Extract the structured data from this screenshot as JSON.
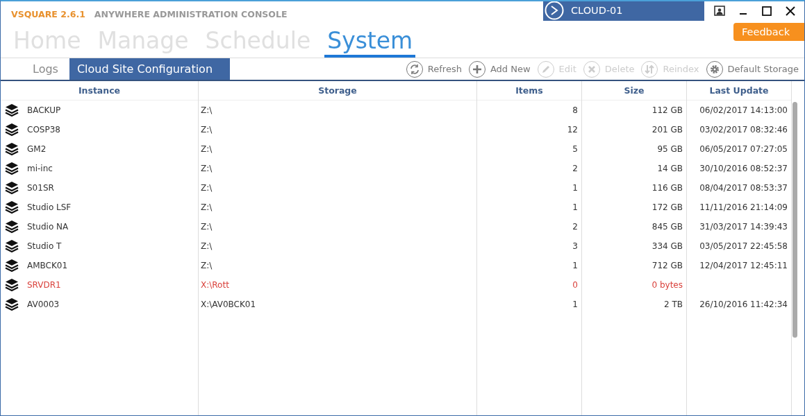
{
  "app": {
    "name": "VSQUARE 2.6.1",
    "subtitle": "ANYWHERE ADMINISTRATION CONSOLE"
  },
  "server": {
    "label": "CLOUD-01"
  },
  "feedback": "Feedback",
  "nav": [
    {
      "label": "Home",
      "selected": false
    },
    {
      "label": "Manage",
      "selected": false
    },
    {
      "label": "Schedule",
      "selected": false
    },
    {
      "label": "System",
      "selected": true
    }
  ],
  "subtabs": [
    {
      "label": "Logs",
      "selected": false
    },
    {
      "label": "Cloud Site Configuration",
      "selected": true
    }
  ],
  "toolbar": [
    {
      "kind": "refresh",
      "label": "Refresh",
      "disabled": false
    },
    {
      "kind": "add",
      "label": "Add New",
      "disabled": false
    },
    {
      "kind": "edit",
      "label": "Edit",
      "disabled": true
    },
    {
      "kind": "delete",
      "label": "Delete",
      "disabled": true
    },
    {
      "kind": "reindex",
      "label": "Reindex",
      "disabled": true
    },
    {
      "kind": "settings",
      "label": "Default Storage",
      "disabled": false
    }
  ],
  "table": {
    "columns": [
      "Instance",
      "Storage",
      "Items",
      "Size",
      "Last Update"
    ],
    "rows": [
      {
        "instance": "BACKUP",
        "storage": "Z:\\",
        "items": "8",
        "size": "112 GB",
        "last_update": "06/02/2017 14:13:00",
        "error": false
      },
      {
        "instance": "COSP38",
        "storage": "Z:\\",
        "items": "12",
        "size": "201 GB",
        "last_update": "03/02/2017 08:32:46",
        "error": false
      },
      {
        "instance": "GM2",
        "storage": "Z:\\",
        "items": "5",
        "size": "95 GB",
        "last_update": "06/05/2017 07:27:05",
        "error": false
      },
      {
        "instance": "mi-inc",
        "storage": "Z:\\",
        "items": "2",
        "size": "14 GB",
        "last_update": "30/10/2016 08:52:37",
        "error": false
      },
      {
        "instance": "S01SR",
        "storage": "Z:\\",
        "items": "1",
        "size": "116 GB",
        "last_update": "08/04/2017 08:53:37",
        "error": false
      },
      {
        "instance": "Studio LSF",
        "storage": "Z:\\",
        "items": "1",
        "size": "172 GB",
        "last_update": "11/11/2016 21:14:09",
        "error": false
      },
      {
        "instance": "Studio NA",
        "storage": "Z:\\",
        "items": "2",
        "size": "845 GB",
        "last_update": "31/03/2017 14:39:43",
        "error": false
      },
      {
        "instance": "Studio T",
        "storage": "Z:\\",
        "items": "3",
        "size": "334 GB",
        "last_update": "03/05/2017 22:45:58",
        "error": false
      },
      {
        "instance": "AMBCK01",
        "storage": "Z:\\",
        "items": "1",
        "size": "712 GB",
        "last_update": "12/04/2017 12:45:11",
        "error": false
      },
      {
        "instance": "SRVDR1",
        "storage": "X:\\Rott",
        "items": "0",
        "size": "0 bytes",
        "error": true
      },
      {
        "instance": "AV0003",
        "storage": "X:\\AV0BCK01",
        "items": "1",
        "size": "2 TB",
        "last_update": "26/10/2016 11:42:34",
        "error": false
      }
    ]
  }
}
